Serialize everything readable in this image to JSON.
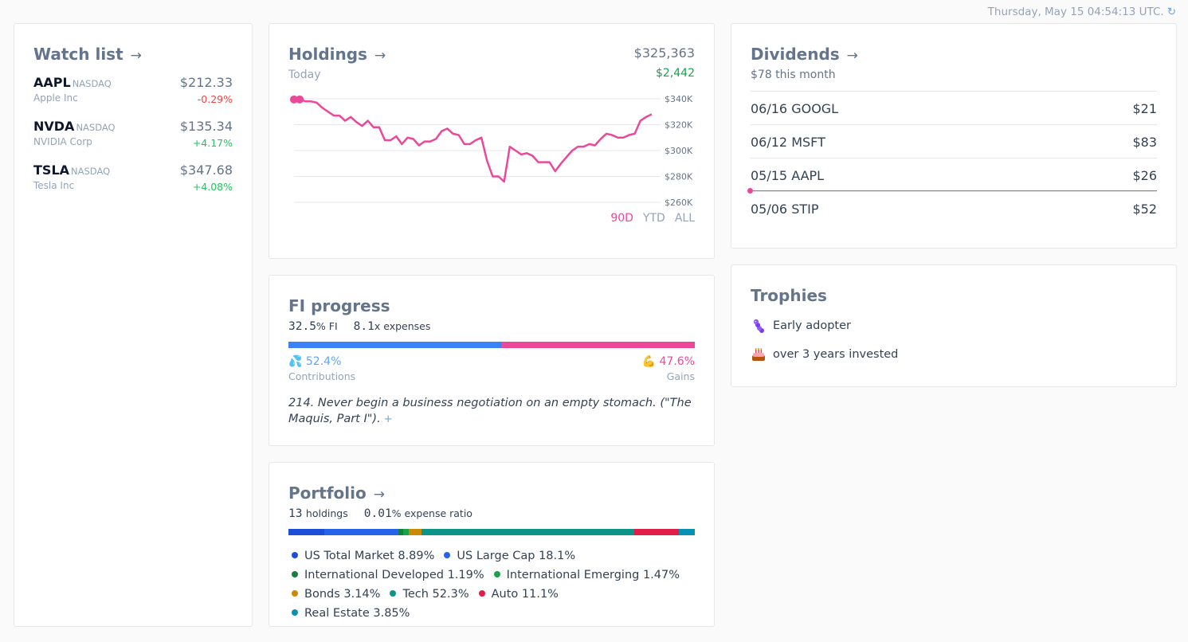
{
  "header": {
    "timestamp": "Thursday, May 15 04:54:13 UTC.",
    "refresh_icon": "↻"
  },
  "watchlist": {
    "title": "Watch list",
    "arrow": "→",
    "items": [
      {
        "symbol": "AAPL",
        "exchange": "NASDAQ",
        "name": "Apple Inc",
        "price": "$212.33",
        "change": "-0.29%",
        "direction": "down"
      },
      {
        "symbol": "NVDA",
        "exchange": "NASDAQ",
        "name": "NVIDIA Corp",
        "price": "$135.34",
        "change": "+4.17%",
        "direction": "up"
      },
      {
        "symbol": "TSLA",
        "exchange": "NASDAQ",
        "name": "Tesla Inc",
        "price": "$347.68",
        "change": "+4.08%",
        "direction": "up"
      }
    ]
  },
  "holdings": {
    "title": "Holdings",
    "arrow": "→",
    "value": "$325,363",
    "period_label": "Today",
    "gain": "$2,442",
    "ranges": [
      "90D",
      "YTD",
      "ALL"
    ],
    "active_range": "90D"
  },
  "chart_data": {
    "type": "line",
    "y_ticks": [
      340000,
      320000,
      300000,
      280000,
      260000
    ],
    "y_tick_labels": [
      "$340K",
      "$320K",
      "$300K",
      "$280K",
      "$260K"
    ],
    "ylim": [
      260000,
      340000
    ],
    "line_color": "#ec4899",
    "grid": true,
    "series": [
      {
        "values": [
          339500,
          339500,
          338000,
          338000,
          337000,
          333000,
          330000,
          327000,
          327000,
          323000,
          326000,
          322000,
          319000,
          323000,
          318000,
          318000,
          308000,
          308000,
          311000,
          305000,
          310000,
          309000,
          304000,
          307000,
          307000,
          309000,
          315000,
          317000,
          313000,
          312000,
          305000,
          305000,
          308000,
          310000,
          292000,
          280000,
          280000,
          276000,
          303000,
          300000,
          297000,
          298000,
          296000,
          291000,
          291000,
          291000,
          284000,
          290000,
          295000,
          300000,
          303000,
          303000,
          305000,
          304000,
          309000,
          313000,
          312000,
          310000,
          310000,
          312000,
          313000,
          323000,
          326000,
          328000
        ]
      }
    ]
  },
  "fi": {
    "title": "FI progress",
    "fi_pct": "32.5",
    "fi_unit": "% FI",
    "expenses_x": "8.1",
    "expenses_unit": "x expenses",
    "contributions_pct": "52.4%",
    "contributions_label": "Contributions",
    "contributions_icon": "💦",
    "gains_pct": "47.6%",
    "gains_label": "Gains",
    "gains_icon": "💪",
    "contributions_share": 52.4,
    "gains_share": 47.6,
    "quote": "214. Never begin a business negotiation on an empty stomach. (\"The Maquis, Part I\").",
    "more": "+"
  },
  "portfolio": {
    "title": "Portfolio",
    "arrow": "→",
    "holdings_count": "13",
    "holdings_label": "holdings",
    "expense_ratio": "0.01",
    "expense_label": "% expense ratio",
    "allocations": [
      {
        "name": "US Total Market",
        "pct": "8.89%",
        "share": 8.89,
        "color": "#1d4ed8"
      },
      {
        "name": "US Large Cap",
        "pct": "18.1%",
        "share": 18.1,
        "color": "#2563eb"
      },
      {
        "name": "International Developed",
        "pct": "1.19%",
        "share": 1.19,
        "color": "#15803d"
      },
      {
        "name": "International Emerging",
        "pct": "1.47%",
        "share": 1.47,
        "color": "#16a34a"
      },
      {
        "name": "Bonds",
        "pct": "3.14%",
        "share": 3.14,
        "color": "#ca8a04"
      },
      {
        "name": "Tech",
        "pct": "52.3%",
        "share": 52.3,
        "color": "#0d9488"
      },
      {
        "name": "Auto",
        "pct": "11.1%",
        "share": 11.1,
        "color": "#e11d48"
      },
      {
        "name": "Real Estate",
        "pct": "3.85%",
        "share": 3.85,
        "color": "#0891b2"
      }
    ]
  },
  "dividends": {
    "title": "Dividends",
    "arrow": "→",
    "subtitle": "$78 this month",
    "rows": [
      {
        "label": "06/16 GOOGL",
        "amount": "$21"
      },
      {
        "label": "06/12 MSFT",
        "amount": "$83"
      },
      {
        "label": "05/15 AAPL",
        "amount": "$26"
      },
      {
        "label": "05/06 STIP",
        "amount": "$52"
      }
    ]
  },
  "trophies": {
    "title": "Trophies",
    "items": [
      {
        "icon": "caterpillar-icon",
        "label": "Early adopter"
      },
      {
        "icon": "birthday-cake-icon",
        "label": "over 3 years invested"
      }
    ]
  }
}
